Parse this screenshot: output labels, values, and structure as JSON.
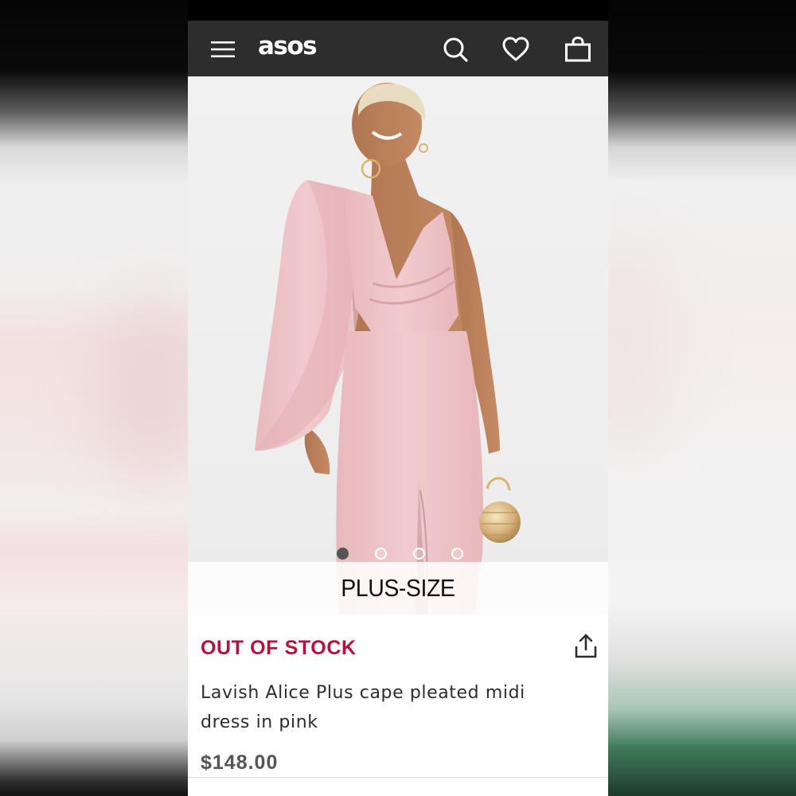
{
  "header": {
    "logo": "asos",
    "icons": [
      "menu-icon",
      "search-icon",
      "heart-icon",
      "bag-icon"
    ]
  },
  "gallery": {
    "image_count": 4,
    "active_index": 0,
    "banner": "PLUS-SIZE"
  },
  "product": {
    "stock_status": "OUT OF STOCK",
    "title": "Lavish Alice Plus cape pleated midi dress in pink",
    "price": "$148.00"
  },
  "colors": {
    "header_bg": "#2d2d2d",
    "stock_red": "#b8103d",
    "dress_pink": "#eec5c8"
  }
}
